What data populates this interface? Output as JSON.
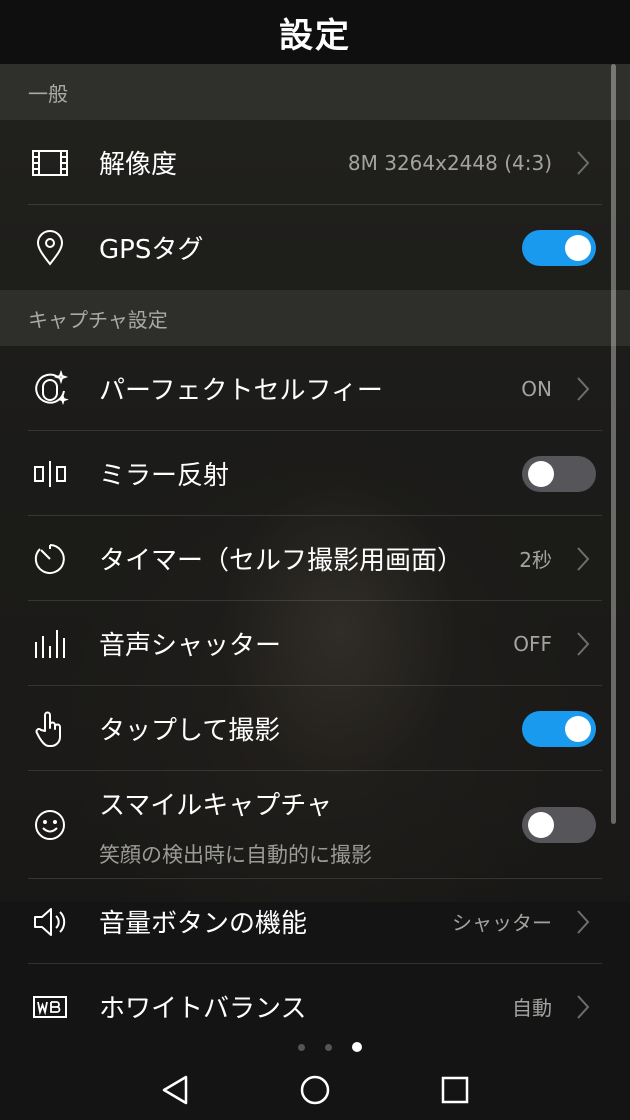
{
  "header": {
    "title": "設定"
  },
  "sections": {
    "general": "一般",
    "capture": "キャプチャ設定"
  },
  "rows": {
    "resolution": {
      "label": "解像度",
      "value": "8M 3264x2448 (4:3)",
      "icon": "resolution-icon"
    },
    "gps": {
      "label": "GPSタグ",
      "toggle": "on",
      "icon": "location-pin-icon"
    },
    "selfie": {
      "label": "パーフェクトセルフィー",
      "value": "ON",
      "icon": "beauty-face-icon"
    },
    "mirror": {
      "label": "ミラー反射",
      "toggle": "off",
      "icon": "mirror-icon"
    },
    "timer": {
      "label": "タイマー（セルフ撮影用画面）",
      "value": "2秒",
      "icon": "timer-icon"
    },
    "audio": {
      "label": "音声シャッター",
      "value": "OFF",
      "icon": "audio-bars-icon"
    },
    "tap": {
      "label": "タップして撮影",
      "toggle": "on",
      "icon": "tap-hand-icon"
    },
    "smile": {
      "label": "スマイルキャプチャ",
      "sub": "笑顔の検出時に自動的に撮影",
      "toggle": "off",
      "icon": "smile-icon"
    },
    "volume": {
      "label": "音量ボタンの機能",
      "value": "シャッター",
      "icon": "speaker-icon"
    },
    "wb": {
      "label": "ホワイトバランス",
      "value": "自動",
      "icon": "wb-icon"
    }
  },
  "pager": {
    "pages": 3,
    "active": 3
  },
  "navbar": {
    "back": "back-icon",
    "home": "home-icon",
    "recents": "recents-icon"
  },
  "colors": {
    "accent": "#1a9aef",
    "toggle_off": "#55555a"
  }
}
